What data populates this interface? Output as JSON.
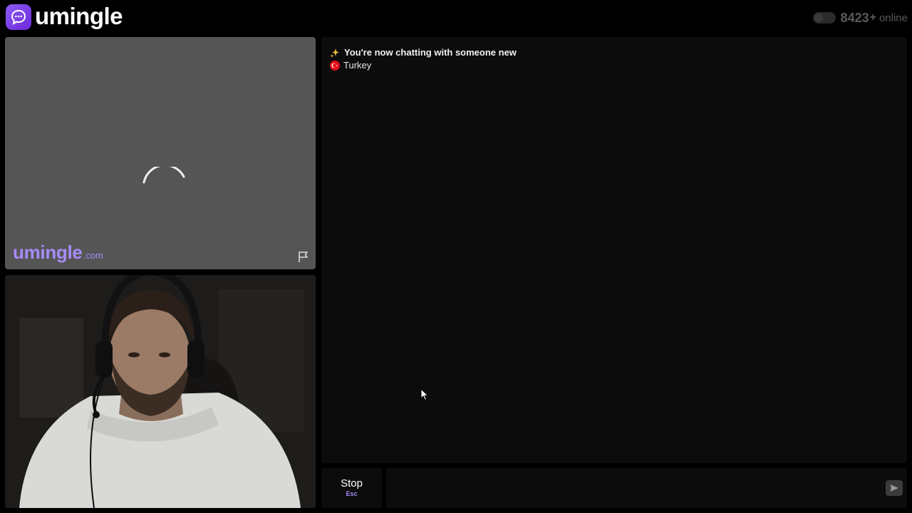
{
  "header": {
    "logo_text": "umingle",
    "online_count": "8423",
    "online_plus": "+",
    "online_label": "online"
  },
  "remote_video": {
    "watermark_main": "umingle",
    "watermark_tld": ".com",
    "state": "loading"
  },
  "chat": {
    "system_message": "You're now chatting with someone new",
    "country": "Turkey",
    "input_value": ""
  },
  "controls": {
    "stop_label": "Stop",
    "stop_shortcut": "Esc"
  },
  "icons": {
    "logo": "chat-bubble-icon",
    "report": "flag-icon",
    "system": "sparkle-icon",
    "country": "turkey-flag-icon",
    "send": "send-icon"
  },
  "colors": {
    "accent": "#a78bfa",
    "brand": "#7c3aed",
    "background": "#000000",
    "panel": "#0c0c0c",
    "video_placeholder": "#555555"
  }
}
